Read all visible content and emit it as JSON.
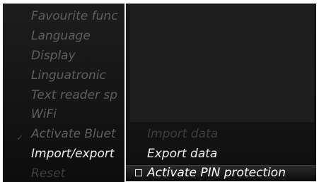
{
  "left_menu": {
    "items": [
      {
        "label": "Favourite func",
        "state": "normal"
      },
      {
        "label": "Language",
        "state": "normal"
      },
      {
        "label": "Display",
        "state": "normal"
      },
      {
        "label": "Linguatronic",
        "state": "normal"
      },
      {
        "label": "Text reader sp",
        "state": "normal"
      },
      {
        "label": "WiFi",
        "state": "normal"
      },
      {
        "label": "Activate Bluet",
        "state": "normal"
      },
      {
        "label": "Import/export",
        "state": "active"
      },
      {
        "label": "Reset",
        "state": "disabled"
      }
    ],
    "check_icon": "checkmark-icon"
  },
  "right_menu": {
    "items": [
      {
        "label": "Import data",
        "state": "disabled"
      },
      {
        "label": "Export data",
        "state": "active"
      }
    ],
    "selected": {
      "label": "Activate PIN protection",
      "checkbox_icon": "checkbox-empty-icon",
      "checked": false
    }
  }
}
